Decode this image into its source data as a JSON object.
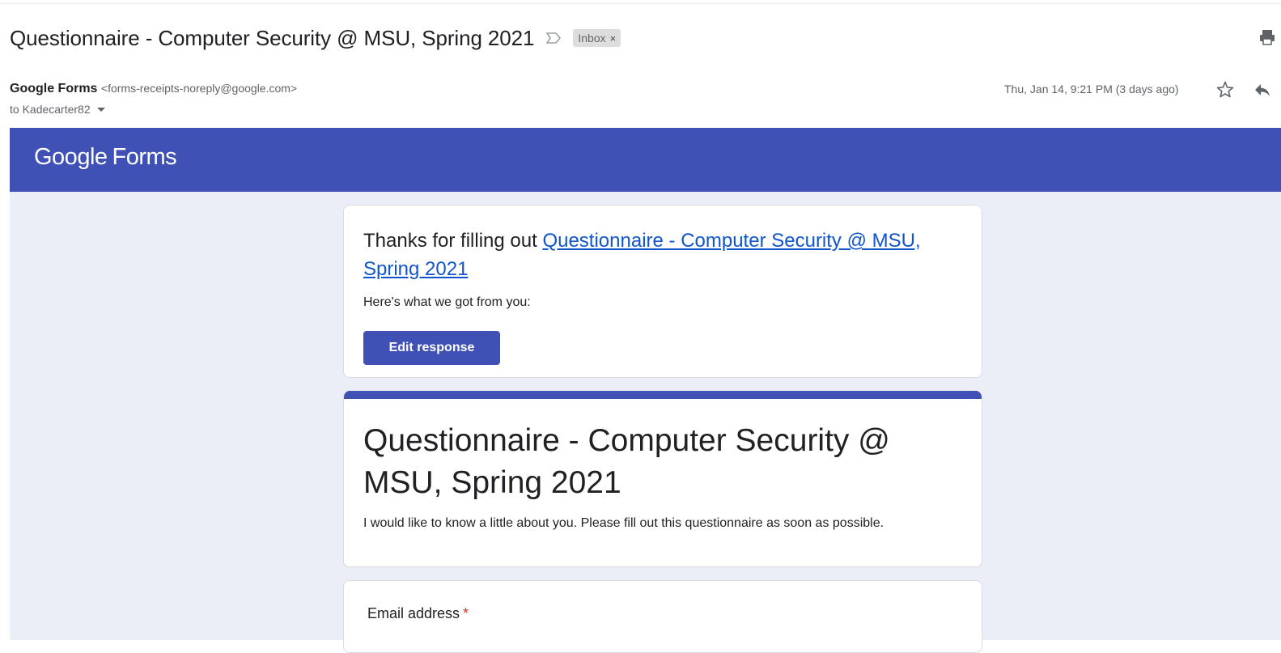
{
  "email": {
    "subject": "Questionnaire - Computer Security @ MSU, Spring 2021",
    "label_chip": "Inbox",
    "label_chip_remove": "×",
    "sender_name": "Google Forms",
    "sender_email": "<forms-receipts-noreply@google.com>",
    "to_line": "to Kadecarter82",
    "date": "Thu, Jan 14, 9:21 PM (3 days ago)",
    "icons": [
      "label-marker-icon",
      "print-icon",
      "star-icon",
      "reply-icon",
      "chevron-down-icon"
    ]
  },
  "forms_header": {
    "brand": "Google",
    "product": "Forms",
    "color": "#3f51b5"
  },
  "receipt": {
    "thanks_prefix": "Thanks for filling out ",
    "form_link": "Questionnaire - Computer Security @ MSU, Spring 2021",
    "got_text": "Here's what we got from you:",
    "edit_button": "Edit response"
  },
  "form": {
    "title": "Questionnaire - Computer Security @ MSU, Spring 2021",
    "description": "I would like to know a little about you. Please fill out this questionnaire as soon as possible.",
    "questions": [
      {
        "label": "Email address",
        "required_mark": "*"
      }
    ]
  },
  "colors": {
    "accent": "#3f51b5",
    "body_background": "#ebedf7",
    "link": "#1155cc",
    "required": "#d93025"
  }
}
